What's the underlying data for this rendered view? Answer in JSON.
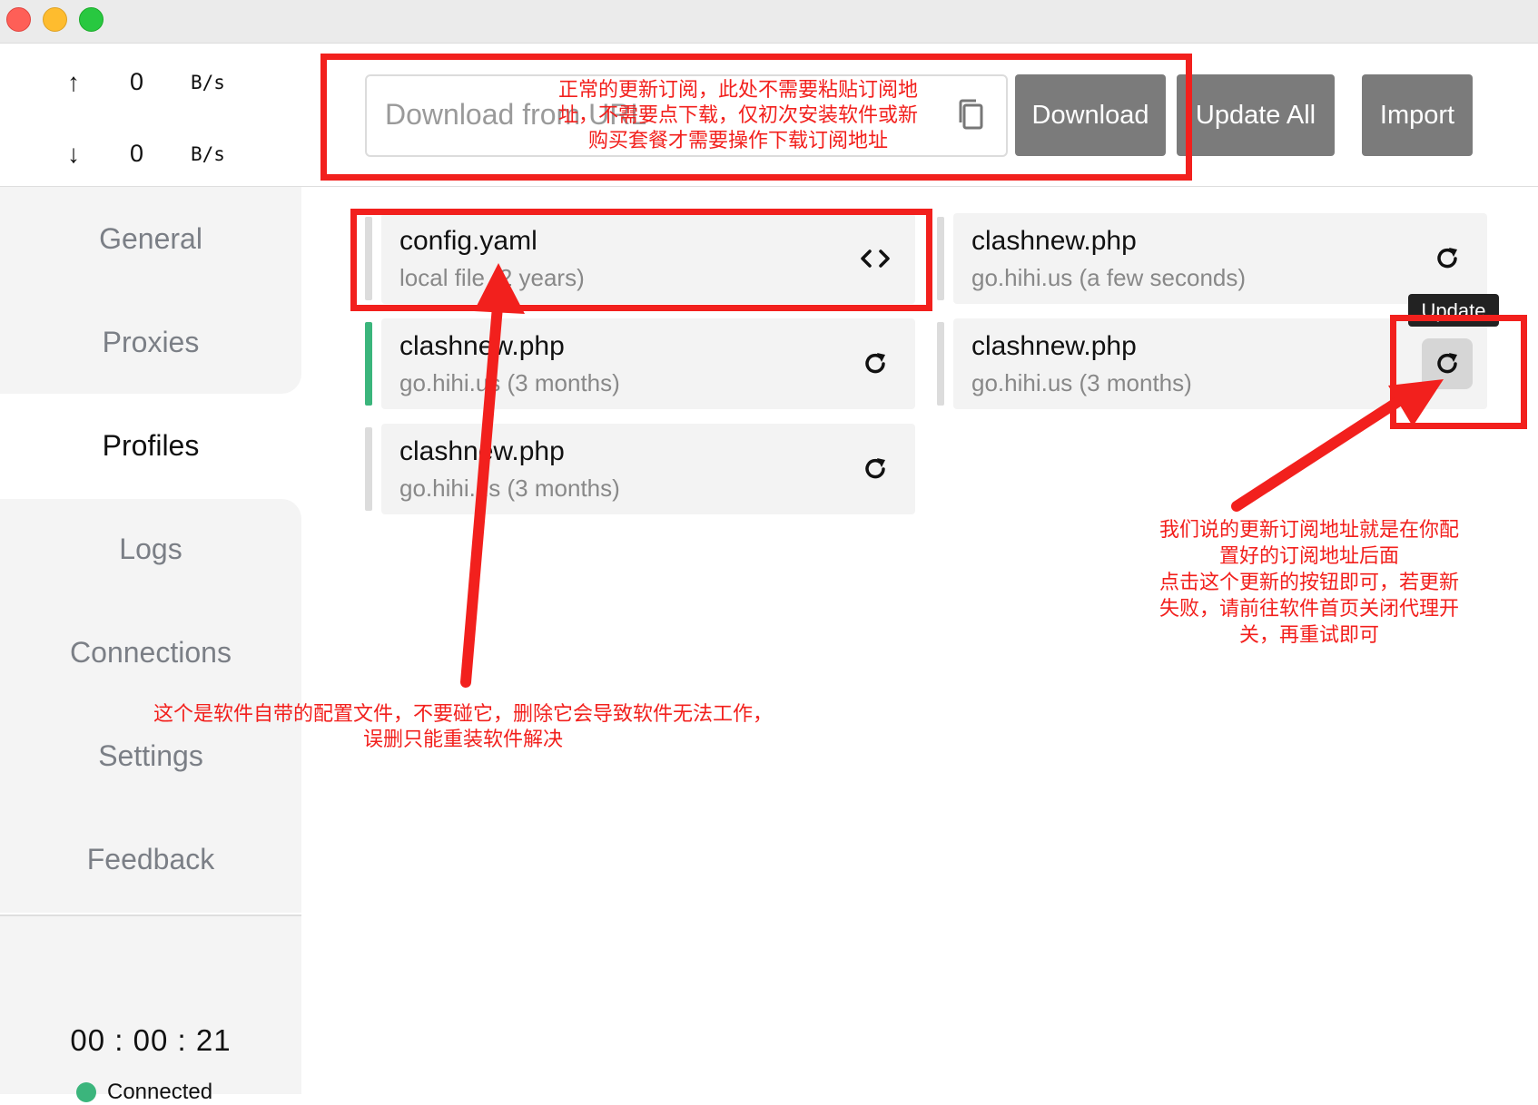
{
  "window": {
    "buttons": [
      "close",
      "minimize",
      "zoom"
    ]
  },
  "traffic": {
    "up": {
      "arrow": "↑",
      "value": "0",
      "unit": "B/s"
    },
    "down": {
      "arrow": "↓",
      "value": "0",
      "unit": "B/s"
    }
  },
  "nav": {
    "items": [
      {
        "label": "General"
      },
      {
        "label": "Proxies"
      },
      {
        "label": "Profiles"
      },
      {
        "label": "Logs"
      },
      {
        "label": "Connections"
      },
      {
        "label": "Settings"
      },
      {
        "label": "Feedback"
      }
    ],
    "active": "Profiles"
  },
  "status": {
    "timer": "00 : 00 : 21",
    "connection": "Connected",
    "color": "#3bb57c"
  },
  "toolbar": {
    "url_placeholder": "Download from URL",
    "download_label": "Download",
    "update_all_label": "Update All",
    "import_label": "Import"
  },
  "profiles": [
    {
      "name": "config.yaml",
      "sub": "local file (2 years)",
      "action_icon": "code-icon"
    },
    {
      "name": "clashnew.php",
      "sub": "go.hihi.us (a few seconds)",
      "action_icon": "refresh-icon"
    },
    {
      "name": "clashnew.php",
      "sub": "go.hihi.us (3 months)",
      "action_icon": "refresh-icon",
      "selected": true
    },
    {
      "name": "clashnew.php",
      "sub": "go.hihi.us (3 months)",
      "action_icon": "refresh-icon",
      "hovered": true
    },
    {
      "name": "clashnew.php",
      "sub": "go.hihi.us (3 months)",
      "action_icon": "refresh-icon"
    }
  ],
  "tooltip": "Update",
  "annotations": {
    "top_note": [
      "正常的更新订阅，此处不需要粘贴订阅地",
      "址，不需要点下载，仅初次安装软件或新",
      "购买套餐才需要操作下载订阅地址"
    ],
    "config_note": [
      "这个是软件自带的配置文件，不要碰它，删除它会导致软件无法工作，",
      "误删只能重装软件解决"
    ],
    "update_note": [
      "我们说的更新订阅地址就是在你配",
      "置好的订阅地址后面",
      "点击这个更新的按钮即可，若更新",
      "失败，请前往软件首页关闭代理开",
      "关，再重试即可"
    ],
    "color": "#f2201d"
  }
}
